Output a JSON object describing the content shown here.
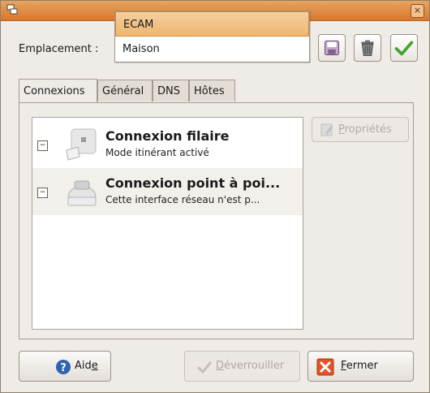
{
  "window": {
    "close_glyph": "×",
    "icon": "network-settings-icon"
  },
  "location": {
    "label": "Emplacement :",
    "dropdown_options": [
      "ECAM",
      "Maison"
    ],
    "selected": "ECAM",
    "toolbar": [
      {
        "name": "save-location-button",
        "icon": "floppy-disk-icon"
      },
      {
        "name": "delete-location-button",
        "icon": "trash-can-icon"
      },
      {
        "name": "apply-location-button",
        "icon": "checkmark-icon"
      }
    ]
  },
  "tabs": [
    {
      "label": "Connexions",
      "active": true
    },
    {
      "label": "Général",
      "active": false
    },
    {
      "label": "DNS",
      "active": false
    },
    {
      "label": "Hôtes",
      "active": false
    }
  ],
  "connections": [
    {
      "name": "Connexion filaire",
      "status": "Mode itinérant activé",
      "toggle": "−",
      "icon": "wired-ethernet-icon"
    },
    {
      "name": "Connexion point à poi...",
      "status": "Cette interface réseau n'est p...",
      "toggle": "−",
      "icon": "telephone-modem-icon"
    }
  ],
  "properties_button": {
    "prefix": "P",
    "rest": "ropriétés",
    "enabled": false
  },
  "buttons": {
    "help": {
      "before": "Aid",
      "mnemonic": "e",
      "after": ""
    },
    "unlock": {
      "before": "",
      "mnemonic": "D",
      "after": "éverrouiller",
      "enabled": false
    },
    "close": {
      "before": "",
      "mnemonic": "F",
      "after": "ermer"
    }
  },
  "colors": {
    "accent": "#e08a3c",
    "window_bg": "#efebe7",
    "close_red": "#e0542a",
    "help_blue": "#2f62b0",
    "check_green": "#4aa232"
  }
}
